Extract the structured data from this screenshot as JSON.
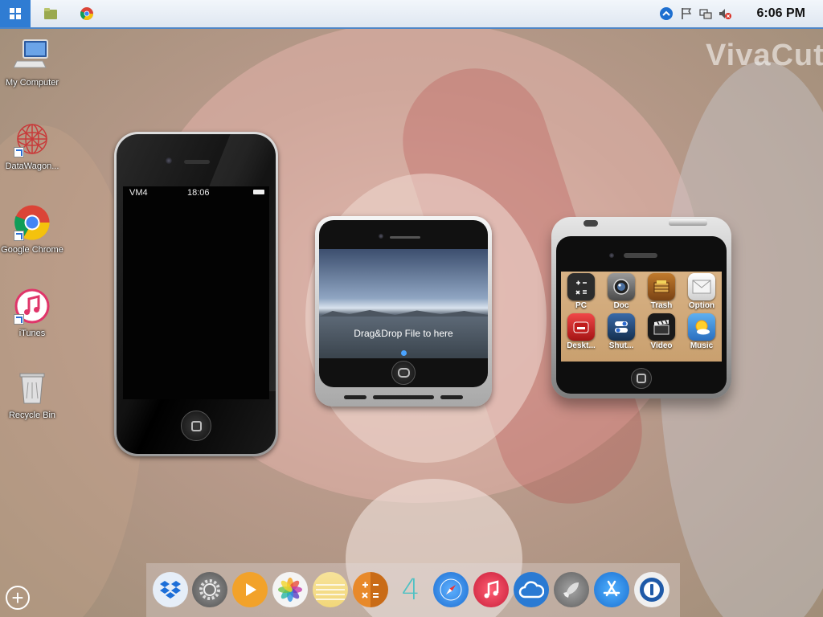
{
  "taskbar": {
    "start_icon": "windows-logo-icon",
    "pinned": [
      {
        "name": "file-manager-icon"
      },
      {
        "name": "chrome-icon"
      }
    ],
    "tray": [
      "up-arrow-icon",
      "flag-icon",
      "network-icon",
      "volume-muted-icon"
    ],
    "clock": "6:06 PM"
  },
  "wallpaper": {
    "logo": "VivaCut"
  },
  "desktop_icons": [
    {
      "label": "My Computer",
      "icon": "computer-icon"
    },
    {
      "label": "DataWagon...",
      "icon": "datawagon-icon"
    },
    {
      "label": "Google Chrome",
      "icon": "chrome-icon"
    },
    {
      "label": "iTunes",
      "icon": "itunes-icon"
    },
    {
      "label": "Recycle Bin",
      "icon": "recycle-bin-icon"
    }
  ],
  "phone1": {
    "carrier": "VM4",
    "time": "18:06"
  },
  "phone2": {
    "drop_text": "Drag&Drop File to here"
  },
  "phone3": {
    "apps": [
      {
        "label": "PC",
        "icon": "calculator-icon",
        "color": "#2c2c2c"
      },
      {
        "label": "Doc",
        "icon": "camera-icon",
        "color": "#6b6b6b"
      },
      {
        "label": "Trash",
        "icon": "trash-crate-icon",
        "color": "#a5631f"
      },
      {
        "label": "Option",
        "icon": "mail-icon",
        "color": "#e9e9e9"
      },
      {
        "label": "Deskt...",
        "icon": "mailbox-icon",
        "color": "#d82525"
      },
      {
        "label": "Shut...",
        "icon": "switch-icon",
        "color": "#1f3d66"
      },
      {
        "label": "Video",
        "icon": "clapper-icon",
        "color": "#222222"
      },
      {
        "label": "Music",
        "icon": "sun-weather-icon",
        "color": "#3d8fd6"
      }
    ]
  },
  "dock": [
    {
      "name": "dropbox-icon",
      "color": "#e6eef8"
    },
    {
      "name": "settings-gear-icon",
      "color": "#6a6a6a"
    },
    {
      "name": "play-icon",
      "color": "#f2a22a"
    },
    {
      "name": "photos-flower-icon",
      "color": "#f4f4f4"
    },
    {
      "name": "notes-icon",
      "color": "#f7e7a0"
    },
    {
      "name": "calculator-icon",
      "color": "#e8892a"
    },
    {
      "name": "number-four-icon",
      "color": "transparent"
    },
    {
      "name": "safari-compass-icon",
      "color": "#2b8ae6"
    },
    {
      "name": "music-note-icon",
      "color": "#e0344b"
    },
    {
      "name": "cloud-icon",
      "color": "#2a7ad3"
    },
    {
      "name": "rocket-icon",
      "color": "#8a8a8a"
    },
    {
      "name": "app-store-icon",
      "color": "#2c8de8"
    },
    {
      "name": "password-keyhole-icon",
      "color": "#1f5aa8"
    }
  ],
  "dock_digit": "4"
}
